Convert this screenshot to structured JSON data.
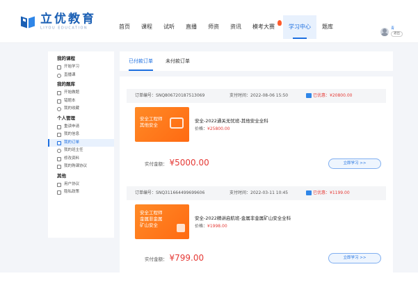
{
  "brand": {
    "name": "立优教育",
    "subtitle": "LIYOU EDUCATION"
  },
  "nav": {
    "items": [
      "首页",
      "课程",
      "试听",
      "直播",
      "师资",
      "资讯",
      "模考大赛",
      "学习中心",
      "题库"
    ],
    "active_index": 7
  },
  "user": {
    "name": "青",
    "logout_label": "退出"
  },
  "sidebar": {
    "group_courses": "我的课程",
    "item_start_study": "开始学习",
    "item_live": "直播课",
    "group_questions": "我的题库",
    "item_start_practice": "开始做题",
    "item_wrong": "错题本",
    "item_favorites": "我的收藏",
    "group_personal": "个人管理",
    "item_retake": "重读申请",
    "item_messages": "我的信息",
    "item_orders": "我的订单",
    "item_teacher": "我的班主任",
    "item_edit_profile": "修改资料",
    "item_agreement": "我的购课协议",
    "group_other": "其他",
    "item_user_agreement": "用户协议",
    "item_privacy": "隐私政策"
  },
  "tabs": {
    "paid": "已付款订单",
    "unpaid": "未付款订单"
  },
  "orders": [
    {
      "order_no_label": "订单编号：",
      "order_no": "SNQ806720187513069",
      "pay_time_label": "支付时间：",
      "pay_time": "2022-08-06 15:50",
      "coupon_label": "已优惠：",
      "coupon": "¥20800.00",
      "thumb_text": "安全工程师\n其他安全",
      "title": "安全-2022通关无忧班-其他安全全科",
      "price_label": "价格：",
      "price": "¥25800.00",
      "paid_label": "实付金额：",
      "paid_amount": "¥5000.00",
      "button": "立即学习 >>"
    },
    {
      "order_no_label": "订单编号：",
      "order_no": "SNQ311664499699606",
      "pay_time_label": "支付时间：",
      "pay_time": "2022-03-11 10:45",
      "coupon_label": "已优惠：",
      "coupon": "¥1199.00",
      "thumb_text": "安全工程师\n金属非金属\n矿山安全",
      "title": "安全-2022精讲启航班-金属非金属矿山安全全科",
      "price_label": "价格：",
      "price": "¥1998.00",
      "paid_label": "实付金额：",
      "paid_amount": "¥799.00",
      "button": "立即学习 >>"
    }
  ]
}
